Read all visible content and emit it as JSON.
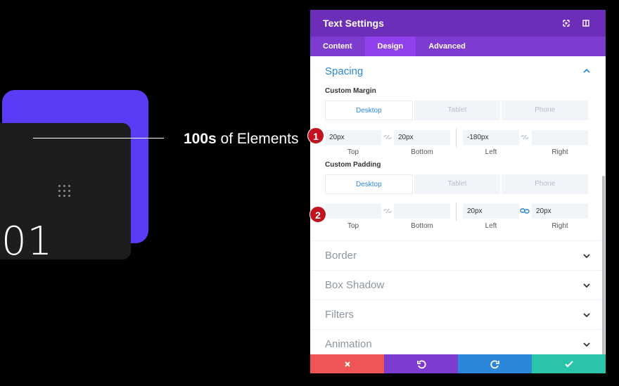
{
  "preview": {
    "number": "01",
    "headline_bold": "100s",
    "headline_rest": " of Elements"
  },
  "modal": {
    "title": "Text Settings",
    "tabs": [
      {
        "label": "Content",
        "active": false
      },
      {
        "label": "Design",
        "active": true
      },
      {
        "label": "Advanced",
        "active": false
      }
    ],
    "spacing": {
      "title": "Spacing",
      "custom_margin": {
        "label": "Custom Margin",
        "devices": [
          "Desktop",
          "Tablet",
          "Phone"
        ],
        "active_device": "Desktop",
        "fields": [
          {
            "label": "Top",
            "value": "20px"
          },
          {
            "label": "Bottom",
            "value": "20px"
          },
          {
            "label": "Left",
            "value": "-180px"
          },
          {
            "label": "Right",
            "value": ""
          }
        ],
        "badge": "1"
      },
      "custom_padding": {
        "label": "Custom Padding",
        "devices": [
          "Desktop",
          "Tablet",
          "Phone"
        ],
        "active_device": "Desktop",
        "fields": [
          {
            "label": "Top",
            "value": ""
          },
          {
            "label": "Bottom",
            "value": ""
          },
          {
            "label": "Left",
            "value": "20px"
          },
          {
            "label": "Right",
            "value": "20px"
          }
        ],
        "badge": "2"
      }
    },
    "sections": [
      "Border",
      "Box Shadow",
      "Filters",
      "Animation"
    ],
    "footer": [
      {
        "name": "cancel",
        "icon": "close-icon",
        "color": "#ef5555"
      },
      {
        "name": "undo",
        "icon": "undo-icon",
        "color": "#7e3bd0"
      },
      {
        "name": "redo",
        "icon": "redo-icon",
        "color": "#2b87da"
      },
      {
        "name": "save",
        "icon": "check-icon",
        "color": "#29c4a9"
      }
    ]
  }
}
